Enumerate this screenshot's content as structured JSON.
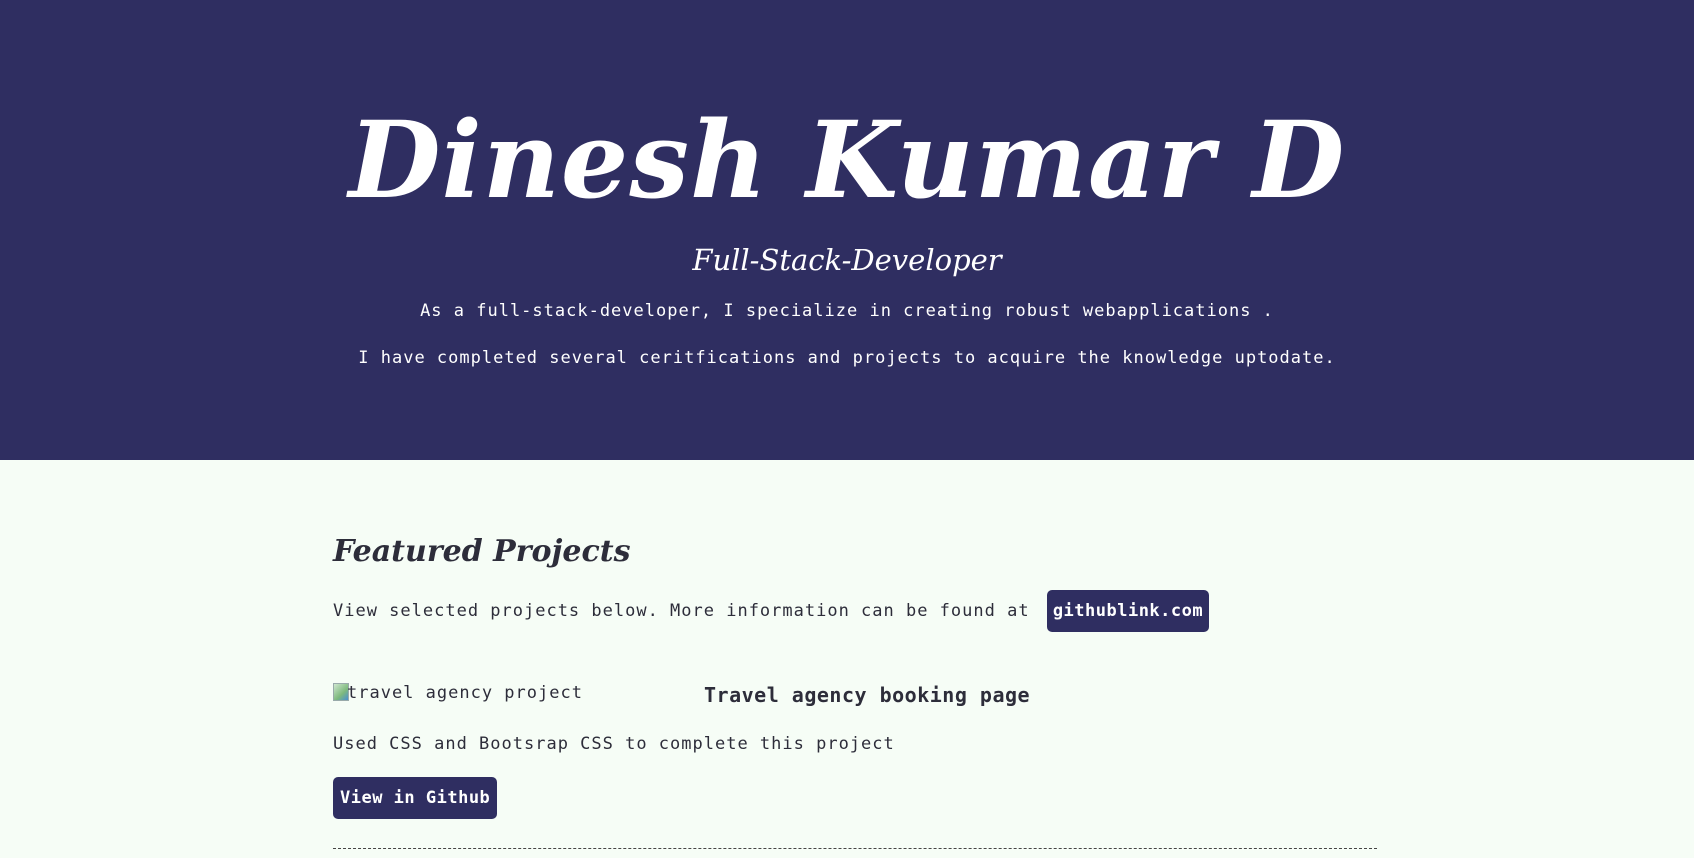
{
  "hero": {
    "name": "Dinesh Kumar D",
    "role": "Full-Stack-Developer",
    "line1": "As a full-stack-developer, I specialize in creating robust webapplications .",
    "line2": "I have completed several ceritfications and projects to acquire the knowledge uptodate."
  },
  "projects": {
    "heading": "Featured Projects",
    "intro": "View selected projects below. More information can be found at",
    "intro_link": "githublink.com",
    "items": [
      {
        "image_alt": "travel agency project",
        "title": "Travel agency booking page",
        "description": "Used CSS and Bootsrap CSS to complete this project",
        "button": "View in Github"
      }
    ]
  },
  "colors": {
    "hero_bg": "#2f2e61",
    "page_bg": "#f6fdf6",
    "accent": "#2f2e61"
  }
}
